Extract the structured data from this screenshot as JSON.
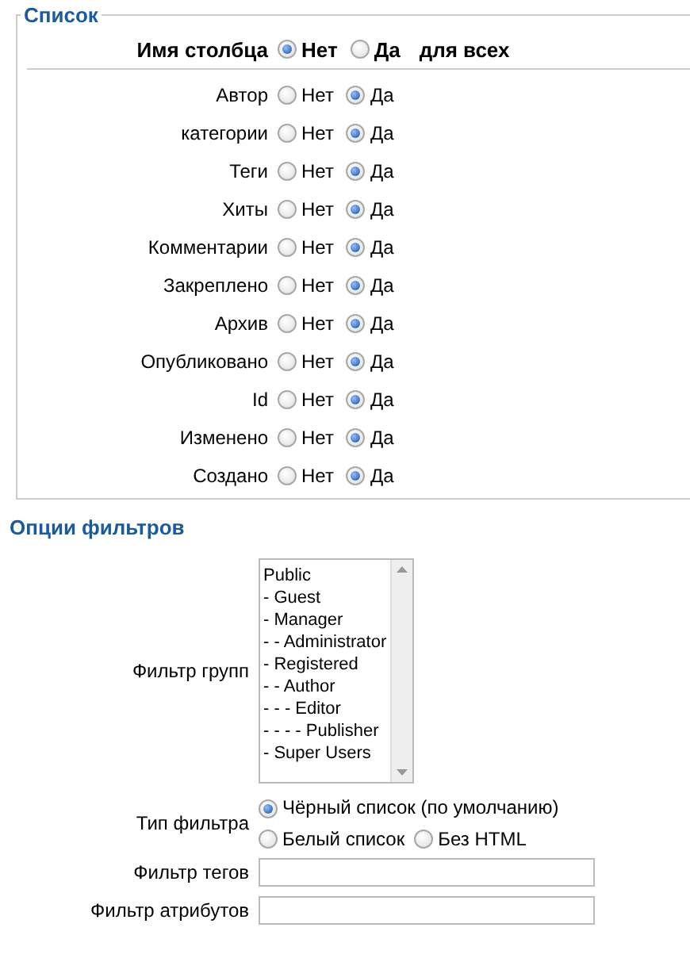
{
  "list": {
    "legend": "Список",
    "header": {
      "label": "Имя столбца",
      "options": [
        {
          "label": "Нет",
          "selected": true
        },
        {
          "label": "Да",
          "selected": false
        }
      ],
      "suffix": "для всех"
    },
    "rows": [
      {
        "label": "Автор",
        "options": [
          {
            "label": "Нет",
            "selected": false
          },
          {
            "label": "Да",
            "selected": true
          }
        ]
      },
      {
        "label": "категории",
        "options": [
          {
            "label": "Нет",
            "selected": false
          },
          {
            "label": "Да",
            "selected": true
          }
        ]
      },
      {
        "label": "Теги",
        "options": [
          {
            "label": "Нет",
            "selected": false
          },
          {
            "label": "Да",
            "selected": true
          }
        ]
      },
      {
        "label": "Хиты",
        "options": [
          {
            "label": "Нет",
            "selected": false
          },
          {
            "label": "Да",
            "selected": true
          }
        ]
      },
      {
        "label": "Комментарии",
        "options": [
          {
            "label": "Нет",
            "selected": false
          },
          {
            "label": "Да",
            "selected": true
          }
        ]
      },
      {
        "label": "Закреплено",
        "options": [
          {
            "label": "Нет",
            "selected": false
          },
          {
            "label": "Да",
            "selected": true
          }
        ]
      },
      {
        "label": "Архив",
        "options": [
          {
            "label": "Нет",
            "selected": false
          },
          {
            "label": "Да",
            "selected": true
          }
        ]
      },
      {
        "label": "Опубликовано",
        "options": [
          {
            "label": "Нет",
            "selected": false
          },
          {
            "label": "Да",
            "selected": true
          }
        ]
      },
      {
        "label": "Id",
        "options": [
          {
            "label": "Нет",
            "selected": false
          },
          {
            "label": "Да",
            "selected": true
          }
        ]
      },
      {
        "label": "Изменено",
        "options": [
          {
            "label": "Нет",
            "selected": false
          },
          {
            "label": "Да",
            "selected": true
          }
        ]
      },
      {
        "label": "Создано",
        "options": [
          {
            "label": "Нет",
            "selected": false
          },
          {
            "label": "Да",
            "selected": true
          }
        ]
      }
    ]
  },
  "filters": {
    "title": "Опции фильтров",
    "group_filter": {
      "label": "Фильтр групп",
      "items": [
        "Public",
        "- Guest",
        "- Manager",
        "- - Administrator",
        "- Registered",
        "- - Author",
        "- - - Editor",
        "- - - - Publisher",
        "- Super Users"
      ]
    },
    "filter_type": {
      "label": "Тип фильтра",
      "options": [
        {
          "label": "Чёрный список (по умолчанию)",
          "selected": true
        },
        {
          "label": "Белый список",
          "selected": false
        },
        {
          "label": "Без HTML",
          "selected": false
        }
      ]
    },
    "tag_filter": {
      "label": "Фильтр тегов"
    },
    "attribute_filter": {
      "label": "Фильтр атрибутов"
    }
  }
}
